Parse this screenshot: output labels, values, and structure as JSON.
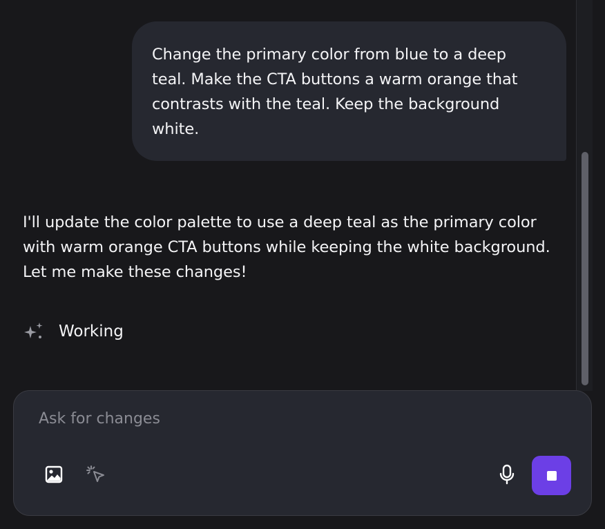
{
  "chat": {
    "user_message": "Change the primary color from blue to a deep teal. Make the CTA buttons a warm orange that contrasts with the teal. Keep the background white.",
    "assistant_message": "I'll update the color palette to use a deep teal as the primary color with warm orange CTA buttons while keeping the white background. Let me make these changes!",
    "status": {
      "icon": "sparkle-icon",
      "label": "Working"
    }
  },
  "composer": {
    "placeholder": "Ask for changes",
    "value": "",
    "icons": {
      "attach": "image-icon",
      "select": "cursor-select-icon",
      "voice": "microphone-icon",
      "stop": "stop-icon"
    }
  },
  "colors": {
    "background": "#18181b",
    "bubble": "#262830",
    "accent": "#6c3fe6",
    "text": "#f4f4f6",
    "placeholder": "#8b8c94"
  }
}
